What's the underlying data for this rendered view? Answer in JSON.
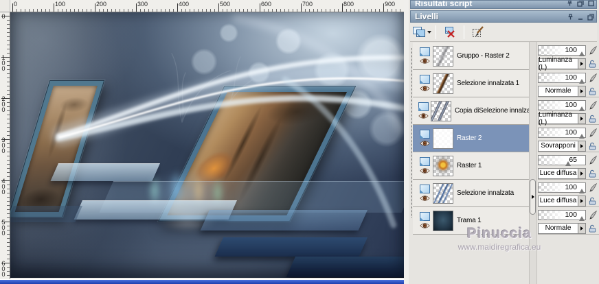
{
  "titlebars": {
    "script_results": {
      "title": "Risultati script"
    },
    "layers": {
      "title": "Livelli"
    }
  },
  "rulers": {
    "h": [
      "0",
      "100",
      "200",
      "300",
      "400",
      "500",
      "600",
      "700",
      "800",
      "900"
    ],
    "v": [
      "0",
      "100",
      "200",
      "300",
      "400",
      "500",
      "600"
    ]
  },
  "layers_panel": {
    "toolbar_icons": [
      "new-layer-icon",
      "delete-layer-icon",
      "edit-selection-icon"
    ],
    "items": [
      {
        "name": "Gruppo - Raster 2",
        "opacity": "100",
        "blend": "Luminanza (L)",
        "selected": false,
        "thumb": "thumb-art thumb-streak"
      },
      {
        "name": "Selezione innalzata 1",
        "opacity": "100",
        "blend": "Normale",
        "selected": false,
        "thumb": "thumb-art thumb-log"
      },
      {
        "name": "Copia diSelezione innalza",
        "opacity": "100",
        "blend": "Luminanza (L)",
        "selected": false,
        "thumb": "thumb-art thumb-frames"
      },
      {
        "name": "Raster 2",
        "opacity": "100",
        "blend": "Sovrapponi",
        "selected": true,
        "thumb": "thumb-art thumb-white"
      },
      {
        "name": "Raster 1",
        "opacity": "65",
        "blend": "Luce diffusa",
        "selected": false,
        "thumb": "thumb-art thumb-flower"
      },
      {
        "name": "Selezione innalzata",
        "opacity": "100",
        "blend": "Luce diffusa",
        "selected": false,
        "thumb": "thumb-art thumb-bluestrokes"
      },
      {
        "name": "Trama 1",
        "opacity": "100",
        "blend": "Normale",
        "selected": false,
        "thumb": "thumb-art thumb-trama"
      }
    ]
  },
  "watermark": {
    "line1": "Pinuccia",
    "line2": "www.maidiregrafica.eu"
  },
  "colors": {
    "selected_row": "#7b93b8",
    "titlebar_top": "#a9bccd",
    "titlebar_bottom": "#7e94ac",
    "window_active_border": "#2a55c8",
    "frame_border_blue": "#4c7490"
  }
}
